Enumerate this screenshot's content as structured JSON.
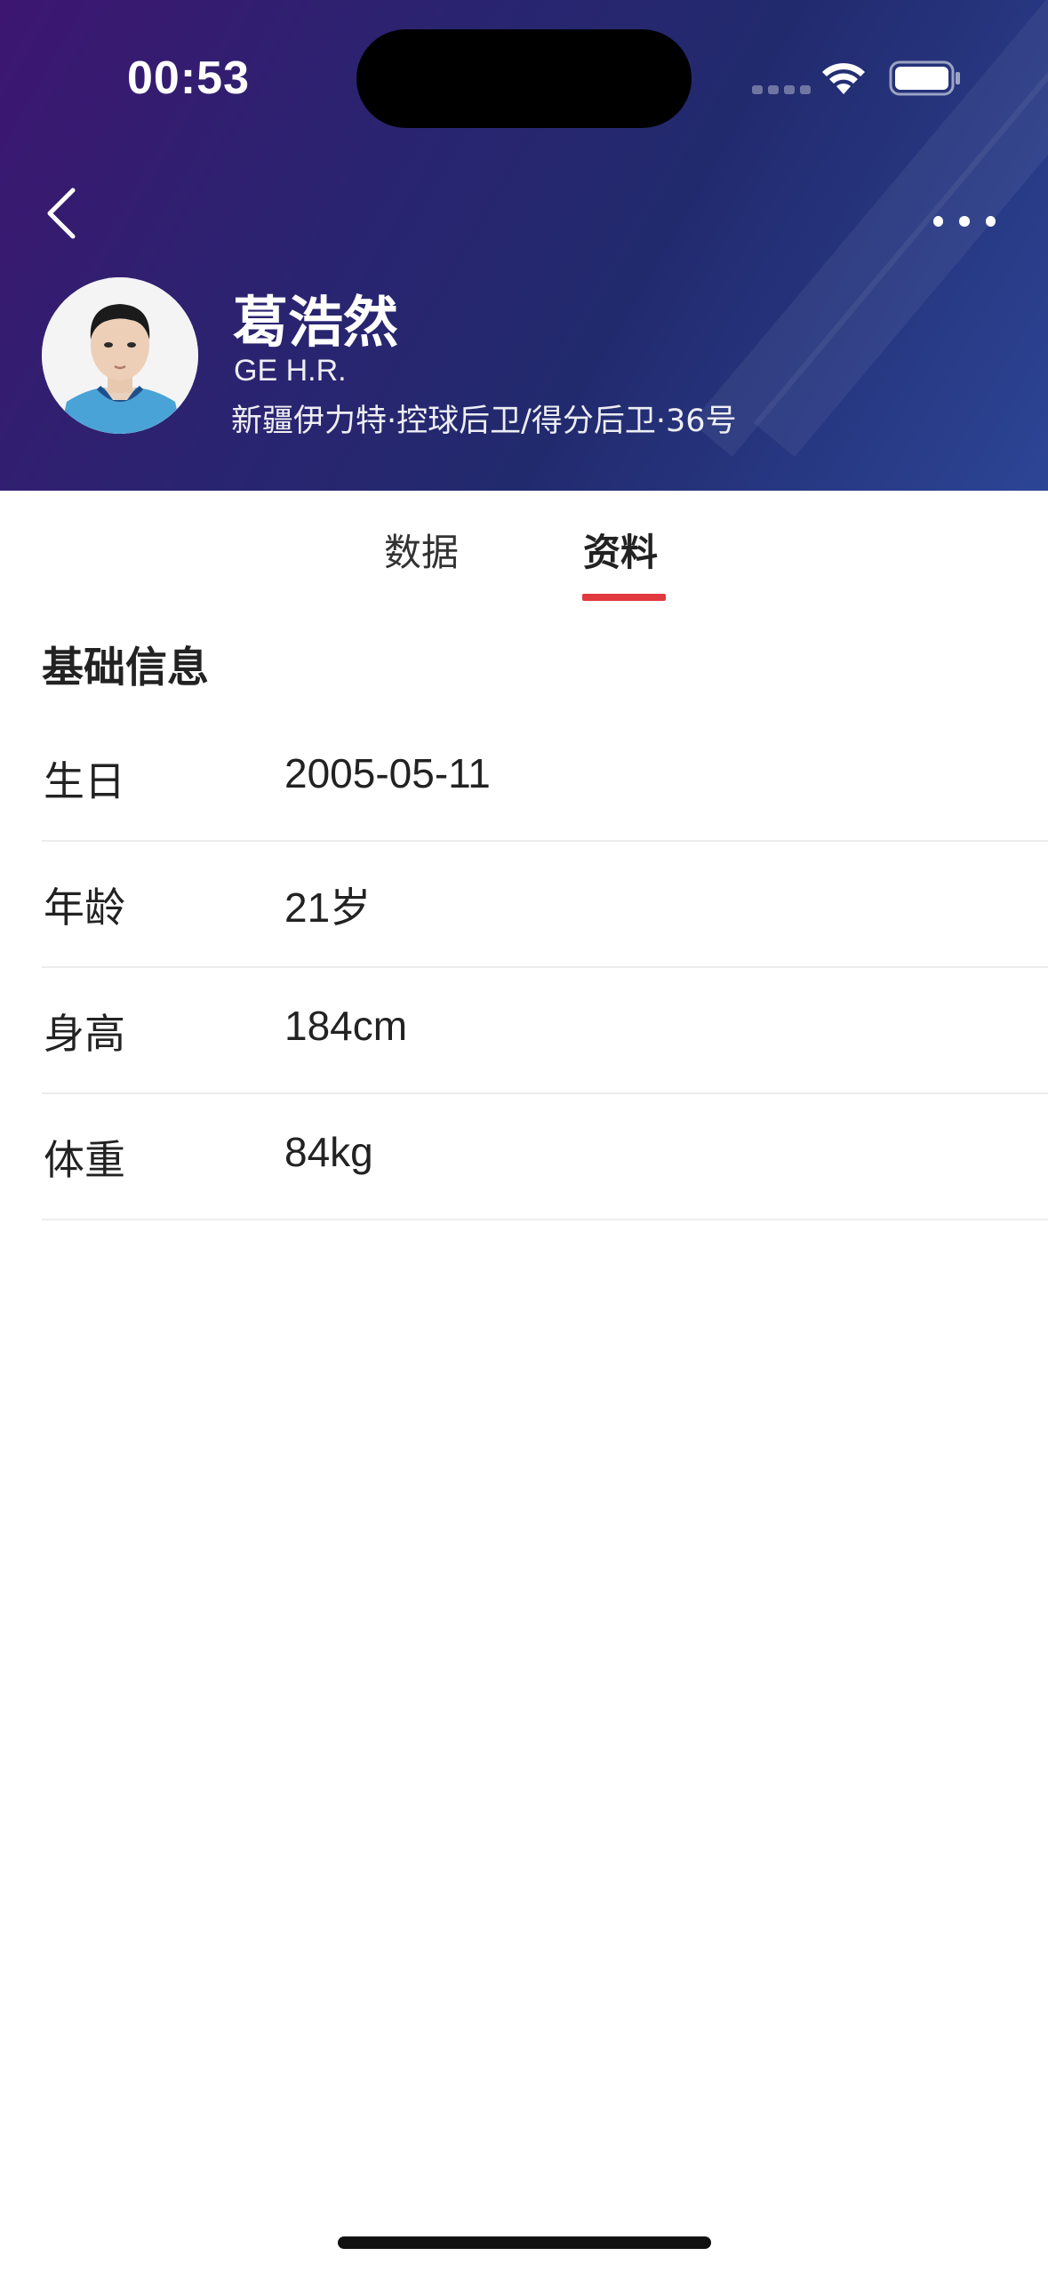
{
  "status_bar": {
    "time": "00:53"
  },
  "player": {
    "name": "葛浩然",
    "english_name": "GE H.R.",
    "info": "新疆伊力特·控球后卫/得分后卫·36号"
  },
  "tabs": [
    {
      "label": "数据",
      "active": false
    },
    {
      "label": "资料",
      "active": true
    }
  ],
  "section": {
    "title": "基础信息"
  },
  "basic_info": [
    {
      "label": "生日",
      "value": "2005-05-11"
    },
    {
      "label": "年龄",
      "value": "21岁"
    },
    {
      "label": "身高",
      "value": "184cm"
    },
    {
      "label": "体重",
      "value": "84kg"
    }
  ],
  "colors": {
    "accent": "#e0393e",
    "header_start": "#3d1671",
    "header_end": "#2c4595"
  }
}
